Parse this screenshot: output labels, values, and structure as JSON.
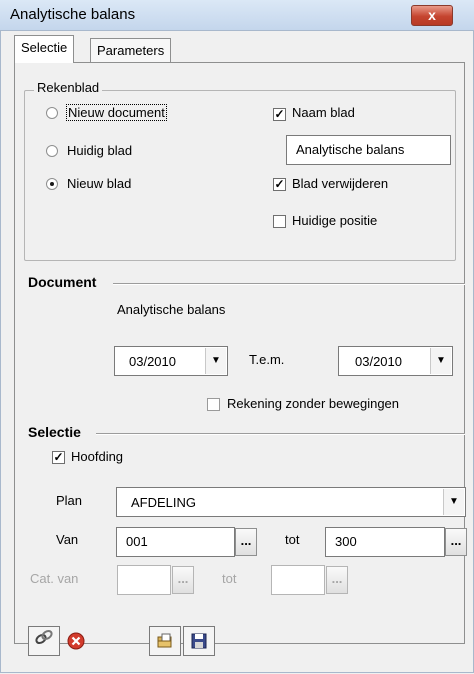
{
  "window": {
    "title": "Analytische balans",
    "close_glyph": "x"
  },
  "tabs": [
    {
      "label": "Selectie"
    },
    {
      "label": "Parameters"
    }
  ],
  "rekenblad": {
    "label": "Rekenblad",
    "radio_nieuw_document": "Nieuw document",
    "radio_huidig_blad": "Huidig blad",
    "radio_nieuw_blad": "Nieuw blad",
    "check_naam_blad": "Naam blad",
    "naam_blad_value": "Analytische balans",
    "check_blad_verwijderen": "Blad verwijderen",
    "check_huidige_positie": "Huidige positie"
  },
  "document": {
    "title": "Document",
    "name": "Analytische balans",
    "from_period": "03/2010",
    "to_label": "T.e.m.",
    "to_period": "03/2010",
    "rekening_zonder": "Rekening zonder bewegingen"
  },
  "selectie": {
    "title": "Selectie",
    "hoofding": "Hoofding",
    "plan_label": "Plan",
    "plan_value": "AFDELING",
    "van_label": "Van",
    "van_value": "001",
    "tot_label": "tot",
    "tot_value": "300",
    "cat_van_label": "Cat. van",
    "cat_tot_label": "tot",
    "ellipsis": "..."
  },
  "icons": {
    "execute": "chain-link-icon",
    "cancel": "red-x-icon",
    "open": "folder-open-icon",
    "save": "floppy-save-icon"
  }
}
